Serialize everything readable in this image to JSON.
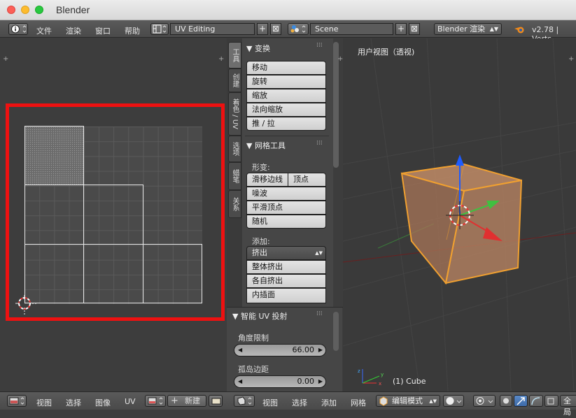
{
  "window": {
    "title": "Blender"
  },
  "infobar": {
    "menus": [
      "文件",
      "渲染",
      "窗口",
      "帮助"
    ],
    "screen_layout": "UV Editing",
    "scene": "Scene",
    "render_engine": "Blender 渲染",
    "version": "v2.78 | Verts"
  },
  "uv_editor": {
    "header_menus": [
      "视图",
      "选择",
      "图像",
      "UV"
    ],
    "new_label": "新建"
  },
  "tool_shelf": {
    "tabs": [
      "工具",
      "创建",
      "着色 / UV",
      "选项",
      "蜡笔",
      "关系"
    ],
    "transform": {
      "title": "▼ 变换",
      "buttons": [
        "移动",
        "旋转",
        "缩放",
        "法向缩放",
        "推 / 拉"
      ]
    },
    "mesh_tools": {
      "title": "▼ 网格工具",
      "deform_label": "形变:",
      "slide_edge": "滑移边线",
      "vertex": "顶点",
      "deform_buttons": [
        "噪波",
        "平滑顶点",
        "随机"
      ],
      "add_label": "添加:",
      "extrude": "挤出",
      "add_buttons": [
        "整体挤出",
        "各自挤出",
        "内插面"
      ]
    }
  },
  "operator_panel": {
    "title": "▼ 智能 UV 投射",
    "angle_label": "角度限制",
    "angle_value": "66.00",
    "island_label": "孤岛边距",
    "island_value": "0.00"
  },
  "view3d": {
    "view_label": "用户视图（透视)",
    "object_label": "(1) Cube",
    "header_menus": [
      "视图",
      "选择",
      "添加",
      "网格"
    ],
    "mode": "编辑模式",
    "global_label": "全局"
  },
  "colors": {
    "selection_box": "#ee1111",
    "cube_edge": "#f0a030",
    "cube_face": "#b08060"
  }
}
